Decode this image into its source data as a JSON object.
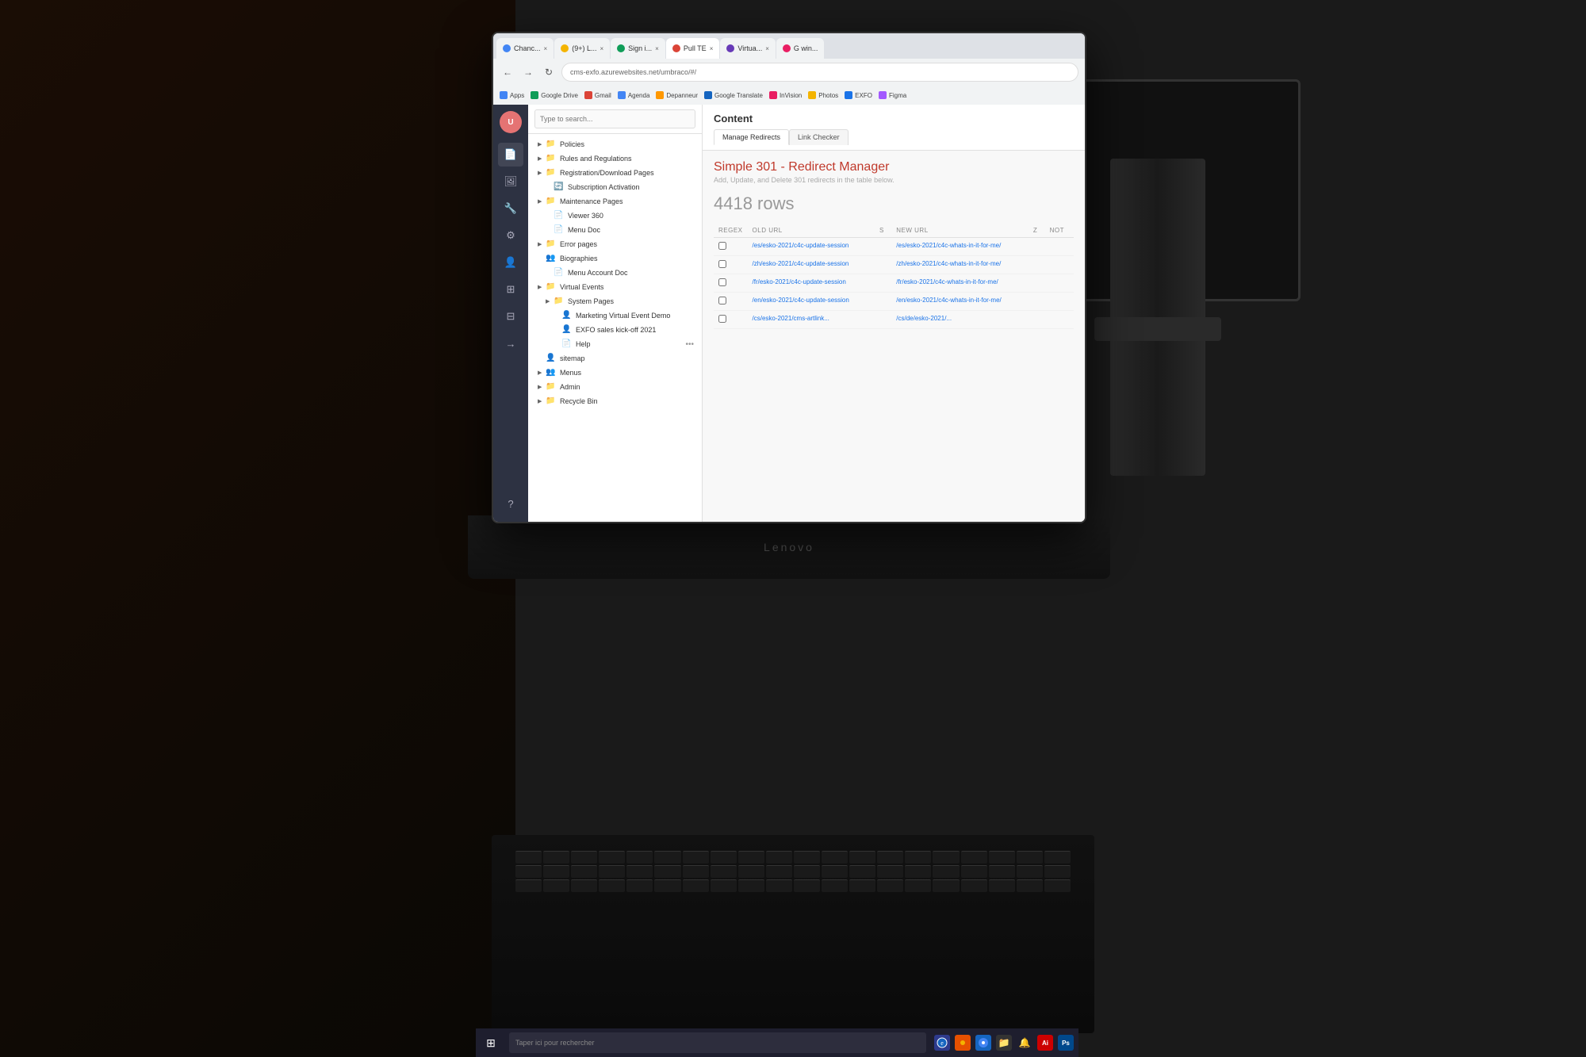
{
  "browser": {
    "address": "cms-exfo.azurewebsites.net/umbraco/#/",
    "tabs": [
      {
        "label": "Chanc...",
        "active": false
      },
      {
        "label": "(9+) L...",
        "active": false
      },
      {
        "label": "Sign i...",
        "active": false
      },
      {
        "label": "Pull TE",
        "active": true
      },
      {
        "label": "Virtua...",
        "active": false
      }
    ],
    "bookmarks": [
      "Apps",
      "Google Drive",
      "Gmail",
      "Agenda",
      "Depanneur",
      "Google Translate",
      "InVision",
      "Photos",
      "EXFO",
      "Figma"
    ]
  },
  "search": {
    "placeholder": "Type to search..."
  },
  "cms_sidebar": {
    "icons": [
      "document",
      "image",
      "wrench",
      "settings",
      "user",
      "grid",
      "table",
      "arrow",
      "help"
    ]
  },
  "content_tree": {
    "items": [
      {
        "label": "Policies",
        "type": "folder",
        "level": 0,
        "hasArrow": true
      },
      {
        "label": "Rules and Regulations",
        "type": "folder",
        "level": 0,
        "hasArrow": true
      },
      {
        "label": "Registration/Download Pages",
        "type": "folder",
        "level": 0,
        "hasArrow": true
      },
      {
        "label": "Subscription Activation",
        "type": "item",
        "level": 1,
        "hasArrow": false
      },
      {
        "label": "Maintenance Pages",
        "type": "folder",
        "level": 0,
        "hasArrow": true
      },
      {
        "label": "Viewer 360",
        "type": "item",
        "level": 1,
        "hasArrow": false
      },
      {
        "label": "Menu Doc",
        "type": "item",
        "level": 1,
        "hasArrow": false
      },
      {
        "label": "Error pages",
        "type": "folder",
        "level": 0,
        "hasArrow": true
      },
      {
        "label": "Biographies",
        "type": "group",
        "level": 0,
        "hasArrow": false
      },
      {
        "label": "Menu Account Doc",
        "type": "item",
        "level": 1,
        "hasArrow": false
      },
      {
        "label": "Virtual Events",
        "type": "folder",
        "level": 0,
        "hasArrow": true
      },
      {
        "label": "System Pages",
        "type": "folder",
        "level": 1,
        "hasArrow": true
      },
      {
        "label": "Marketing Virtual Event Demo",
        "type": "item-special",
        "level": 2,
        "hasArrow": false
      },
      {
        "label": "EXFO sales kick-off 2021",
        "type": "item-special",
        "level": 2,
        "hasArrow": false
      },
      {
        "label": "Help",
        "type": "item",
        "level": 2,
        "hasArrow": false
      },
      {
        "label": "sitemap",
        "type": "user-item",
        "level": 0,
        "hasArrow": false
      },
      {
        "label": "Menus",
        "type": "group",
        "level": 0,
        "hasArrow": true
      },
      {
        "label": "Admin",
        "type": "folder",
        "level": 0,
        "hasArrow": true
      },
      {
        "label": "Recycle Bin",
        "type": "folder",
        "level": 0,
        "hasArrow": true
      }
    ]
  },
  "main_content": {
    "title": "Content",
    "tabs": [
      {
        "label": "Manage Redirects",
        "active": true
      },
      {
        "label": "Link Checker",
        "active": false
      }
    ],
    "redirect_manager": {
      "title": "Simple 301 - Redirect Manager",
      "subtitle": "Add, Update, and Delete 301 redirects in the table below.",
      "rows_count": "4418 rows",
      "table": {
        "headers": [
          "REGEX",
          "OLD URL",
          "S",
          "NEW URL",
          "Z",
          "NOT"
        ],
        "rows": [
          {
            "regex": false,
            "old_url": "/es/esko-2021/c4c-update-session",
            "new_url": "/es/esko-2021/c4c-whats-in-it-for-me/"
          },
          {
            "regex": false,
            "old_url": "/zh/esko-2021/c4c-update-session",
            "new_url": "/zh/esko-2021/c4c-whats-in-it-for-me/"
          },
          {
            "regex": false,
            "old_url": "/fr/esko-2021/c4c-update-session",
            "new_url": "/fr/esko-2021/c4c-whats-in-it-for-me/"
          },
          {
            "regex": false,
            "old_url": "/en/esko-2021/c4c-update-session",
            "new_url": "/en/esko-2021/c4c-whats-in-it-for-me/"
          },
          {
            "regex": false,
            "old_url": "/cs/esko-2021/cms-artlink...",
            "new_url": "/cs/de/esko-2021/..."
          }
        ]
      }
    }
  },
  "taskbar": {
    "search_placeholder": "Taper ici pour rechercher",
    "icons": [
      "⊞",
      "🌐",
      "⚡",
      "🔥",
      "📁",
      "🔔",
      "🎨",
      "✏️"
    ]
  },
  "laptop_brand": "Lenovo"
}
